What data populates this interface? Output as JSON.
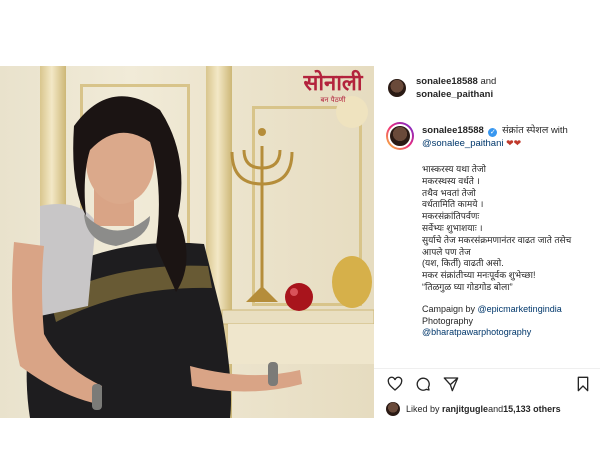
{
  "photo": {
    "alt_subject": "woman in black saree",
    "brand_logo_text": "सोनाली",
    "brand_logo_subtext": "बन पैठणी"
  },
  "header": {
    "account1": "sonalee18588",
    "and": "and",
    "account2": "sonalee_paithani"
  },
  "caption": {
    "username": "sonalee18588",
    "verified_mark": "✓",
    "title": "संक्रांत स्पेशल with",
    "mention": "@sonalee_paithani",
    "hearts": "❤❤",
    "lines": [
      "भास्करस्य यथा तेजो",
      "मकरस्थस्य वर्धते ।",
      "तथैव भवतां तेजो",
      "वर्धतामिति कामये ।",
      "मकरसंक्रांतिपर्वणः",
      "सर्वेभ्यः शुभाशयाः ।",
      "सुर्याचे तेज मकरसंक्रमणानंतर वाढत जाते तसेच",
      "आपले पण तेज",
      "(यश, किर्ती) वाढती असो.",
      "मकर संक्रांतीच्या मनःपूर्वक शुभेच्छा!",
      "“तिळगुळ घ्या गोडगोड बोला”"
    ],
    "credits": [
      {
        "label": "Campaign by ",
        "handle": "@epicmarketingindia"
      },
      {
        "label": "Photography",
        "handle": ""
      },
      {
        "label": "",
        "handle": "@bharatpawarphotography"
      }
    ]
  },
  "likes": {
    "prefix": "Liked by ",
    "user": "ranjitgugle",
    "mid": " and ",
    "count": "15,133 others"
  },
  "icons": [
    "heart-icon",
    "comment-icon",
    "share-icon",
    "bookmark-icon"
  ],
  "colors": {
    "link": "#00376b",
    "verified": "#3897f0",
    "brand": "#b3233d"
  }
}
